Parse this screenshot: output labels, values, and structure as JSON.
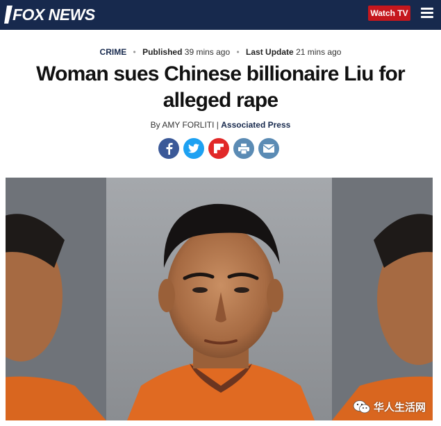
{
  "header": {
    "logo_text": "FOX NEWS",
    "watch_tv_label": "Watch TV",
    "menu_icon": "hamburger-menu-icon",
    "colors": {
      "bar": "#17294d",
      "watch_button": "#c5171d"
    }
  },
  "article": {
    "category": "CRIME",
    "published_label": "Published",
    "published_time": "39 mins ago",
    "updated_label": "Last Update",
    "updated_time": "21 mins ago",
    "headline": "Woman sues Chinese billionaire Liu for alleged rape",
    "byline_prefix": "By AMY FORLITI |",
    "byline_source": "Associated Press"
  },
  "share_buttons": [
    {
      "name": "facebook",
      "icon": "facebook-icon",
      "color": "#3b5998"
    },
    {
      "name": "twitter",
      "icon": "twitter-icon",
      "color": "#1da1f2"
    },
    {
      "name": "flipboard",
      "icon": "flipboard-icon",
      "color": "#e12828"
    },
    {
      "name": "print",
      "icon": "print-icon",
      "color": "#5b8bb4"
    },
    {
      "name": "email",
      "icon": "email-icon",
      "color": "#5b8bb4"
    }
  ],
  "photo": {
    "subject": "mugshot-photo"
  },
  "watermark": {
    "text": "华人生活网",
    "icon": "wechat-icon"
  }
}
